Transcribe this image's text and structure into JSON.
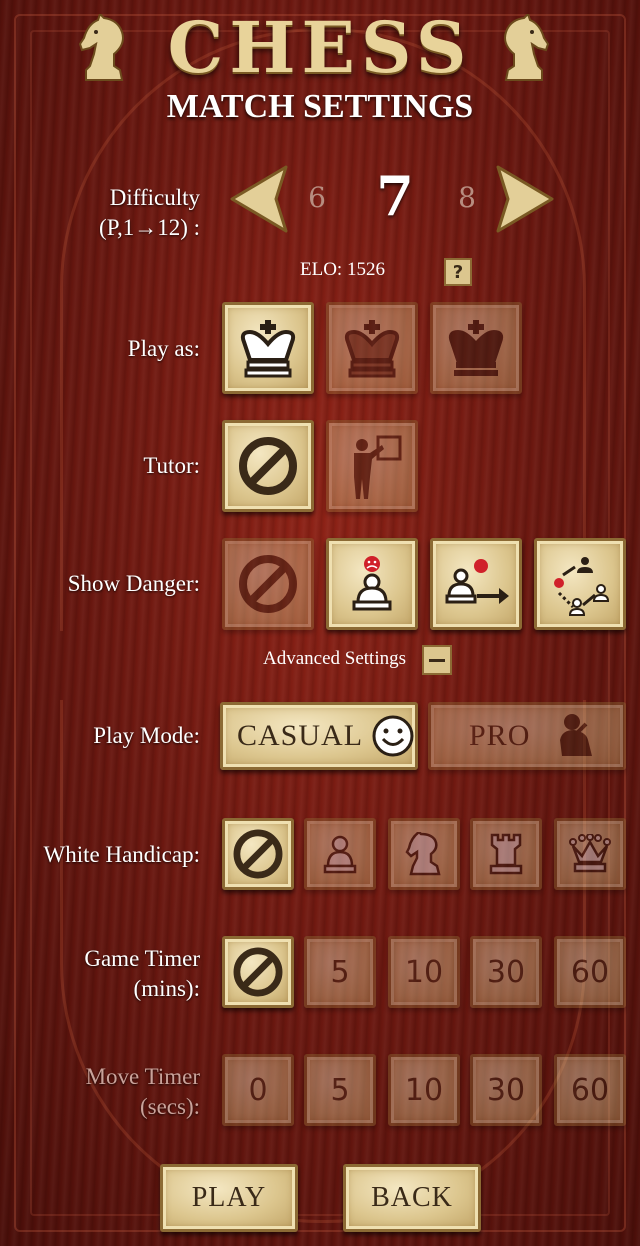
{
  "header": {
    "title": "CHESS",
    "subtitle": "MATCH SETTINGS"
  },
  "difficulty": {
    "label_line1": "Difficulty",
    "label_line2": "(P,1→12) :",
    "previous": "6",
    "current": "7",
    "next": "8",
    "elo_text": "ELO: 1526",
    "help_label": "?"
  },
  "play_as": {
    "label": "Play as:",
    "options": [
      "white-king-icon",
      "random-king-icon",
      "black-king-icon"
    ],
    "selected": 0
  },
  "tutor": {
    "label": "Tutor:",
    "options": [
      "none-icon",
      "tutor-icon"
    ],
    "selected": 0
  },
  "show_danger": {
    "label": "Show Danger:",
    "options": [
      "none-icon",
      "danger-piece-icon",
      "danger-move-icon",
      "danger-all-icon"
    ],
    "selected": [
      1,
      2,
      3
    ]
  },
  "advanced": {
    "label": "Advanced Settings"
  },
  "play_mode": {
    "label": "Play Mode:",
    "casual": "CASUAL",
    "pro": "PRO",
    "selected": "casual"
  },
  "white_handicap": {
    "label": "White Handicap:",
    "options": [
      "none-icon",
      "pawn-icon",
      "knight-icon",
      "rook-icon",
      "queen-icon"
    ],
    "selected": 0
  },
  "game_timer": {
    "label_line1": "Game Timer",
    "label_line2": "(mins):",
    "values": [
      "5",
      "10",
      "30",
      "60"
    ],
    "selected": 0
  },
  "move_timer": {
    "label_line1": "Move Timer",
    "label_line2": "(secs):",
    "values": [
      "0",
      "5",
      "10",
      "30",
      "60"
    ]
  },
  "footer": {
    "play": "PLAY",
    "back": "BACK"
  },
  "colors": {
    "tile": "#dcc68e",
    "tile_border": "#8c6a34",
    "background": "#6d1810",
    "title_gold": "#e8d39a"
  }
}
